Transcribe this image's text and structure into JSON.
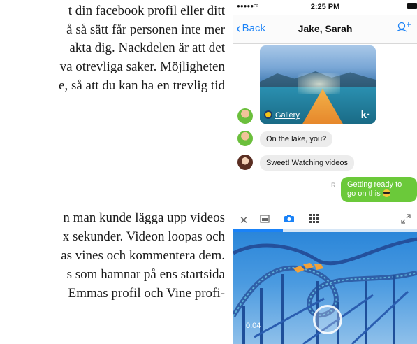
{
  "article": {
    "lines": [
      "t din facebook profil eller ditt",
      "å så sätt får personen inte mer",
      "akta dig. Nackdelen är att det",
      "va otrevliga saker. Möjligheten",
      "e, så att du kan ha en trevlig tid",
      "n man kunde lägga upp videos",
      "x sekunder. Videon loopas och",
      "as vines och kommentera dem.",
      "s som hamnar på ens startsida",
      "Emmas profil och Vine profi-"
    ]
  },
  "phone": {
    "statusbar": {
      "signal": "●●●●●",
      "wifi": "≈",
      "time": "2:25 PM"
    },
    "navbar": {
      "back_label": "Back",
      "title": "Jake, Sarah",
      "add_person_icon": "add-person-icon"
    },
    "chat": {
      "media": {
        "gallery_label": "Gallery",
        "logo": "k·"
      },
      "messages": [
        {
          "sender": "Jake",
          "text": "On the lake, you?"
        },
        {
          "sender": "Sarah",
          "text": "Sweet! Watching videos"
        },
        {
          "sender": "me",
          "text": "Getting ready to go on this"
        }
      ],
      "read_receipt": "R"
    },
    "toolbar": {
      "close_icon": "close-icon",
      "gallery_icon": "photo-gallery-icon",
      "camera_icon": "camera-icon",
      "apps_icon": "apps-grid-icon",
      "expand_icon": "expand-icon"
    },
    "progress": 0.27,
    "video": {
      "timecode": "0:04"
    },
    "colors": {
      "accent": "#1a82f7",
      "my_bubble": "#6bc93a",
      "other_bubble": "#ececec"
    }
  }
}
